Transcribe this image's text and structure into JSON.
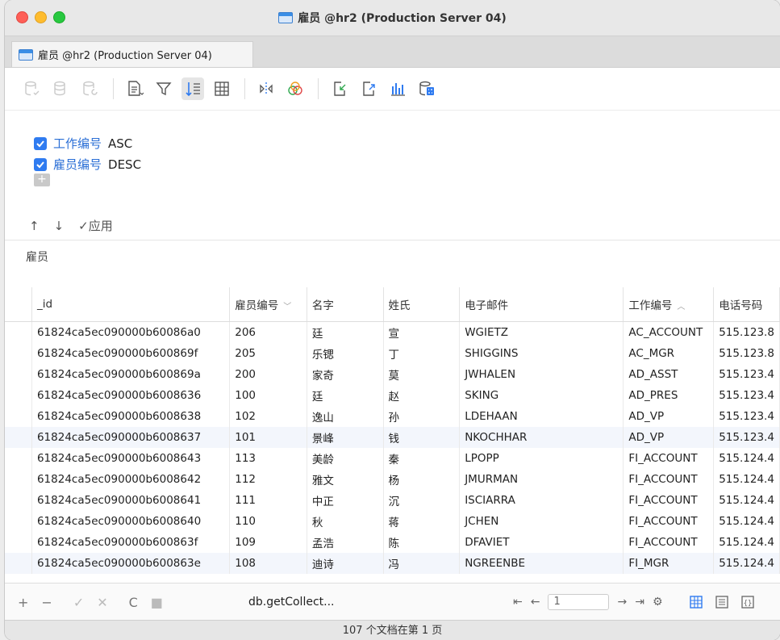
{
  "window": {
    "title": "雇员 @hr2 (Production Server 04)"
  },
  "tab": {
    "label": "雇员 @hr2 (Production Server 04)"
  },
  "sort": {
    "rules": [
      {
        "field": "工作编号",
        "direction": "ASC",
        "checked": true
      },
      {
        "field": "雇员编号",
        "direction": "DESC",
        "checked": true
      }
    ],
    "add_label": "+",
    "move_up": "↑",
    "move_down": "↓",
    "apply_label": "✓应用"
  },
  "section": {
    "label": "雇员"
  },
  "table": {
    "columns": [
      "_id",
      "雇员编号",
      "名字",
      "姓氏",
      "电子邮件",
      "工作编号",
      "电话号码"
    ],
    "rows": [
      [
        "61824ca5ec090000b60086a0",
        "206",
        "廷",
        "宣",
        "WGIETZ",
        "AC_ACCOUNT",
        "515.123.8"
      ],
      [
        "61824ca5ec090000b600869f",
        "205",
        "乐锶",
        "丁",
        "SHIGGINS",
        "AC_MGR",
        "515.123.8"
      ],
      [
        "61824ca5ec090000b600869a",
        "200",
        "家奇",
        "莫",
        "JWHALEN",
        "AD_ASST",
        "515.123.4"
      ],
      [
        "61824ca5ec090000b6008636",
        "100",
        "廷",
        "赵",
        "SKING",
        "AD_PRES",
        "515.123.4"
      ],
      [
        "61824ca5ec090000b6008638",
        "102",
        "逸山",
        "孙",
        "LDEHAAN",
        "AD_VP",
        "515.123.4"
      ],
      [
        "61824ca5ec090000b6008637",
        "101",
        "景峰",
        "钱",
        "NKOCHHAR",
        "AD_VP",
        "515.123.4"
      ],
      [
        "61824ca5ec090000b6008643",
        "113",
        "美龄",
        "秦",
        "LPOPP",
        "FI_ACCOUNT",
        "515.124.4"
      ],
      [
        "61824ca5ec090000b6008642",
        "112",
        "雅文",
        "杨",
        "JMURMAN",
        "FI_ACCOUNT",
        "515.124.4"
      ],
      [
        "61824ca5ec090000b6008641",
        "111",
        "中正",
        "沉",
        "ISCIARRA",
        "FI_ACCOUNT",
        "515.124.4"
      ],
      [
        "61824ca5ec090000b6008640",
        "110",
        "秋",
        "蒋",
        "JCHEN",
        "FI_ACCOUNT",
        "515.124.4"
      ],
      [
        "61824ca5ec090000b600863f",
        "109",
        "孟浩",
        "陈",
        "DFAVIET",
        "FI_ACCOUNT",
        "515.124.4"
      ],
      [
        "61824ca5ec090000b600863e",
        "108",
        "迪诗",
        "冯",
        "NGREENBE",
        "FI_MGR",
        "515.124.4"
      ]
    ],
    "highlighted_row": 5,
    "alt_row": 11
  },
  "statusbar": {
    "query": "db.getCollect...",
    "page_value": "1"
  },
  "footer": {
    "text": "107 个文档在第 1 页"
  },
  "colors": {
    "accent": "#2f7bf0",
    "field_blue": "#2b6fd6"
  }
}
